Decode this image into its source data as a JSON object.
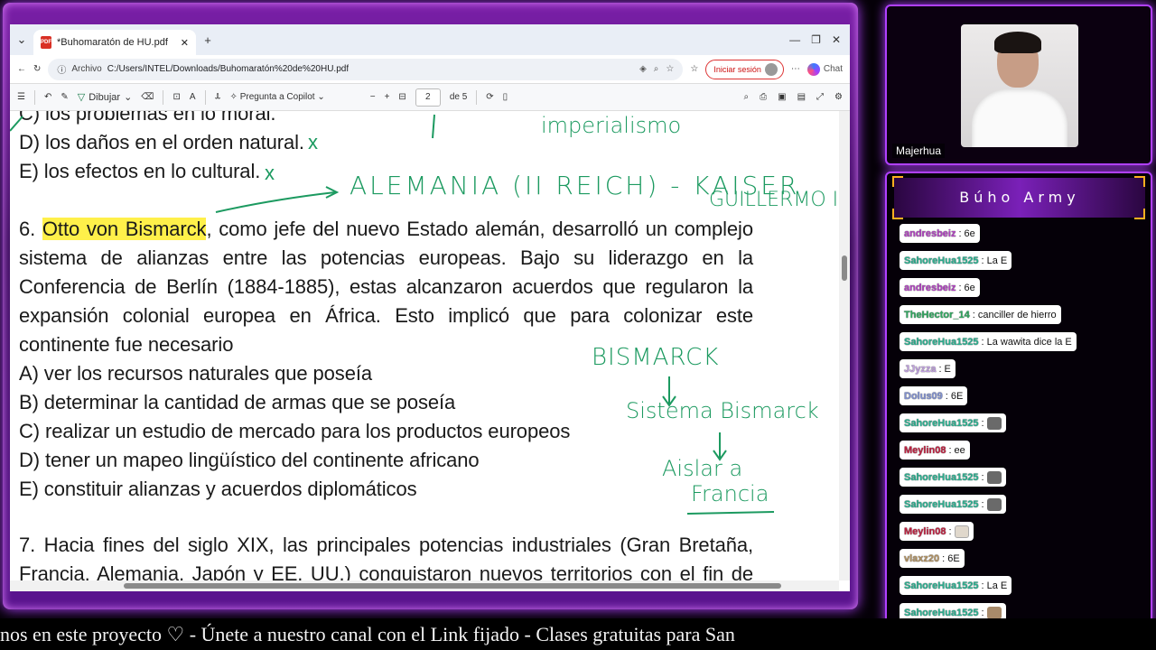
{
  "browser": {
    "tab_title": "*Buhomaratón de HU.pdf",
    "scheme_label": "Archivo",
    "url": "C:/Users/INTEL/Downloads/Buhomaratón%20de%20HU.pdf",
    "signin_label": "Iniciar sesión",
    "chat_label": "Chat"
  },
  "pdf_toolbar": {
    "draw_label": "Dibujar",
    "copilot_label": "Pregunta a Copilot",
    "page_current": "2",
    "page_total": "de 5"
  },
  "document": {
    "line_c_prev": "C) los problemas en lo moral.",
    "line_d_prev": "D) los daños en el orden natural.",
    "line_e_prev": "E) los efectos en lo cultural.",
    "q6_number": "6. ",
    "q6_highlight": "Otto von Bismarck",
    "q6_l1_rest": ", como jefe del nuevo Estado alemán, desarrolló un complejo",
    "q6_l2": "sistema de alianzas entre las potencias europeas. Bajo su liderazgo en la",
    "q6_l3": "Conferencia de Berlín (1884-1885), estas alcanzaron acuerdos que regularon la",
    "q6_l4": "expansión colonial europea en África. Esto implicó que para colonizar este",
    "q6_l5": "continente fue necesario",
    "opt_a": "A) ver los recursos naturales que poseía",
    "opt_b": "B) determinar la cantidad de armas que se poseía",
    "opt_c": "C) realizar un estudio de mercado para los productos europeos",
    "opt_d": "D) tener un mapeo lingüístico del continente africano",
    "opt_e": "E) constituir alianzas y acuerdos diplomáticos",
    "q7_l1": "7. Hacia fines del siglo XIX, las principales potencias industriales (Gran Bretaña,",
    "q7_l2": "Francia, Alemania, Japón y EE. UU.) conquistaron nuevos territorios con el fin de"
  },
  "annotations": {
    "imperialismo": "imperialismo",
    "alemania": "ALEMANIA (II REICH) - KAISER",
    "guillermo": "GUILLERMO I",
    "bismarck": "BISMARCK",
    "sistema": "Sistema Bismarck",
    "aislar": "Aislar a",
    "francia": "Francia",
    "x_mark": "x"
  },
  "webcam": {
    "name": "Majerhua"
  },
  "chat_panel": {
    "title": "Búho Army",
    "messages": [
      {
        "user": "andresbeiz",
        "color": "#b040c0",
        "text": "6e",
        "emote": ""
      },
      {
        "user": "SahoreHua1525",
        "color": "#2ab090",
        "text": "La E",
        "emote": ""
      },
      {
        "user": "andresbeiz",
        "color": "#b040c0",
        "text": "6e",
        "emote": ""
      },
      {
        "user": "TheHector_14",
        "color": "#30a860",
        "text": "canciller de hierro",
        "emote": ""
      },
      {
        "user": "SahoreHua1525",
        "color": "#2ab090",
        "text": "La wawita dice la E",
        "emote": ""
      },
      {
        "user": "JJyzza",
        "color": "#c0a0e0",
        "text": "E",
        "emote": ""
      },
      {
        "user": "Dolus09",
        "color": "#8090d0",
        "text": "6E",
        "emote": ""
      },
      {
        "user": "SahoreHua1525",
        "color": "#2ab090",
        "text": "",
        "emote": "grey"
      },
      {
        "user": "Meylin08",
        "color": "#c02040",
        "text": "ee",
        "emote": ""
      },
      {
        "user": "SahoreHua1525",
        "color": "#2ab090",
        "text": "",
        "emote": "grey"
      },
      {
        "user": "SahoreHua1525",
        "color": "#2ab090",
        "text": "",
        "emote": "grey"
      },
      {
        "user": "Meylin08",
        "color": "#c02040",
        "text": "",
        "emote": "white"
      },
      {
        "user": "vlaxz20",
        "color": "#b09060",
        "text": "6E",
        "emote": ""
      },
      {
        "user": "SahoreHua1525",
        "color": "#2ab090",
        "text": "La E",
        "emote": ""
      },
      {
        "user": "SahoreHua1525",
        "color": "#2ab090",
        "text": "",
        "emote": "tan"
      }
    ]
  },
  "ticker": {
    "text": "nos en este proyecto ♡  -  Únete a nuestro canal con el Link fijado  -  Clases gratuitas para San"
  },
  "colors": {
    "neon_purple": "#b040ff",
    "annotation_green": "#1c9a60",
    "highlight_yellow": "#fff04a"
  }
}
